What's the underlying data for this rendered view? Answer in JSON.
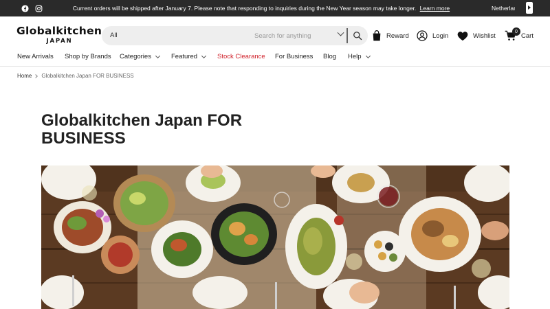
{
  "announcement": {
    "message": "Current orders will be shipped after January 7. Please note that responding to inquiries during the New Year season may take longer.",
    "link_text": "Learn more",
    "country": "Netherlands"
  },
  "social": [
    "facebook-icon",
    "instagram-icon"
  ],
  "logo": {
    "line1": "Globalkitchen",
    "line2": "JAPAN"
  },
  "search": {
    "category_value": "All",
    "placeholder": "Search for anything"
  },
  "header": {
    "reward_label": "Reward",
    "login_label": "Login",
    "wishlist_label": "Wishlist",
    "cart_label": "Cart",
    "cart_count": "0"
  },
  "nav": {
    "items": [
      {
        "label": "New Arrivals"
      },
      {
        "label": "Shop by Brands"
      },
      {
        "label": "Categories"
      },
      {
        "label": "Featured"
      },
      {
        "label": "Stock Clearance"
      },
      {
        "label": "For Business"
      },
      {
        "label": "Blog"
      },
      {
        "label": "Help"
      }
    ]
  },
  "breadcrumb": {
    "home": "Home",
    "current": "Globalkitchen Japan FOR BUSINESS"
  },
  "page": {
    "title": "Globalkitchen Japan FOR BUSINESS"
  },
  "colors": {
    "topbar": "#2a2a2a",
    "sale": "#d0212a",
    "search_bg": "#eeeeee"
  }
}
